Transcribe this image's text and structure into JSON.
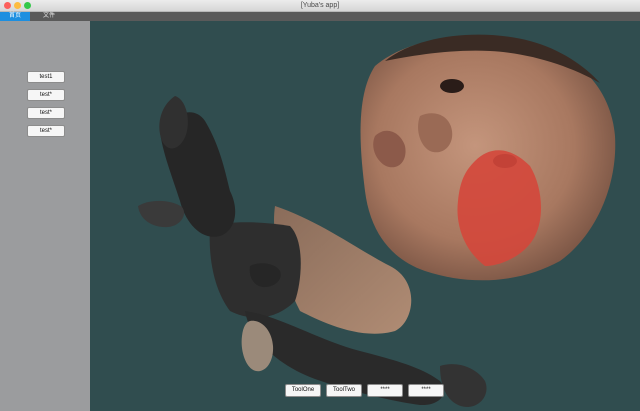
{
  "window": {
    "title": "[Yuba's app]"
  },
  "tabs": [
    {
      "label": "首页",
      "active": true
    },
    {
      "label": "文件",
      "active": false
    }
  ],
  "sidebar": {
    "buttons": [
      {
        "label": "test1"
      },
      {
        "label": "test*"
      },
      {
        "label": "test*"
      },
      {
        "label": "test*"
      }
    ]
  },
  "viewport": {
    "content": "3d-scanned-figure",
    "background_color": "#304d4f"
  },
  "toolbar": {
    "buttons": [
      {
        "label": "ToolOne"
      },
      {
        "label": "ToolTwo"
      },
      {
        "label": "****"
      },
      {
        "label": "****"
      }
    ]
  },
  "colors": {
    "tab_active": "#1d8fe0",
    "sidebar": "#9b9c9e",
    "tabbar": "#5a5a5a"
  }
}
